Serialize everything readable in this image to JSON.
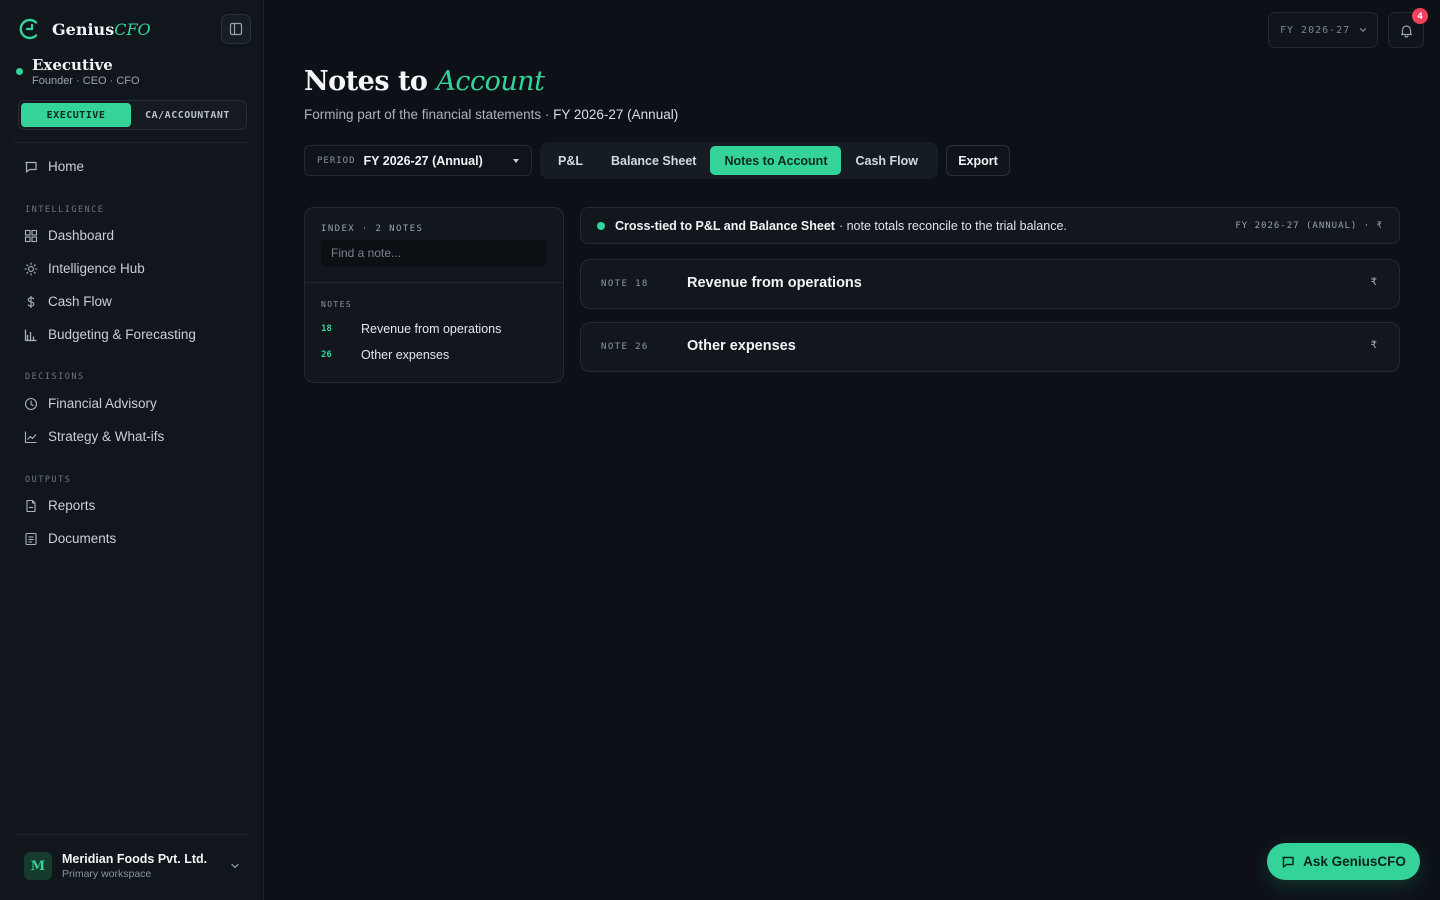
{
  "brand": {
    "name": "Genius",
    "accent": "CFO"
  },
  "role": {
    "title": "Executive",
    "subtitle": "Founder · CEO · CFO"
  },
  "mode_toggle": {
    "active": "EXECUTIVE",
    "inactive": "CA/ACCOUNTANT"
  },
  "nav": {
    "home": "Home",
    "sections": [
      {
        "label": "INTELLIGENCE",
        "items": [
          "Dashboard",
          "Intelligence Hub",
          "Cash Flow",
          "Budgeting & Forecasting"
        ]
      },
      {
        "label": "DECISIONS",
        "items": [
          "Financial Advisory",
          "Strategy & What-ifs"
        ]
      },
      {
        "label": "OUTPUTS",
        "items": [
          "Reports",
          "Documents"
        ]
      }
    ]
  },
  "workspace": {
    "initial": "M",
    "name": "Meridian Foods Pvt. Ltd.",
    "subtitle": "Primary workspace"
  },
  "topbar": {
    "fy": "FY 2026-27",
    "notifications": "4"
  },
  "page": {
    "title_plain": "Notes to",
    "title_accent": "Account",
    "subtitle_lead": "Forming part of the financial statements · ",
    "subtitle_period": "FY 2026-27 (Annual)"
  },
  "controls": {
    "period_label": "PERIOD",
    "period_value": "FY 2026-27 (Annual)",
    "tabs": [
      "P&L",
      "Balance Sheet",
      "Notes to Account",
      "Cash Flow"
    ],
    "active_tab": "Notes to Account",
    "export": "Export"
  },
  "index": {
    "heading": "INDEX · 2 NOTES",
    "search_placeholder": "Find a note...",
    "notes_label": "NOTES",
    "notes": [
      {
        "num": "18",
        "title": "Revenue from operations"
      },
      {
        "num": "26",
        "title": "Other expenses"
      }
    ]
  },
  "tie_banner": {
    "strong": "Cross-tied to P&L and Balance Sheet",
    "rest": "· note totals reconcile to the trial balance.",
    "meta": "FY 2026-27 (ANNUAL) · ₹"
  },
  "notes": [
    {
      "tag": "NOTE 18",
      "title": "Revenue from operations",
      "currency": "₹"
    },
    {
      "tag": "NOTE 26",
      "title": "Other expenses",
      "currency": "₹"
    }
  ],
  "ask_button": "Ask GeniusCFO",
  "colors": {
    "accent": "#34d399",
    "background": "#0d1117",
    "sidebar": "#11161d",
    "badge": "#f43f5e"
  }
}
